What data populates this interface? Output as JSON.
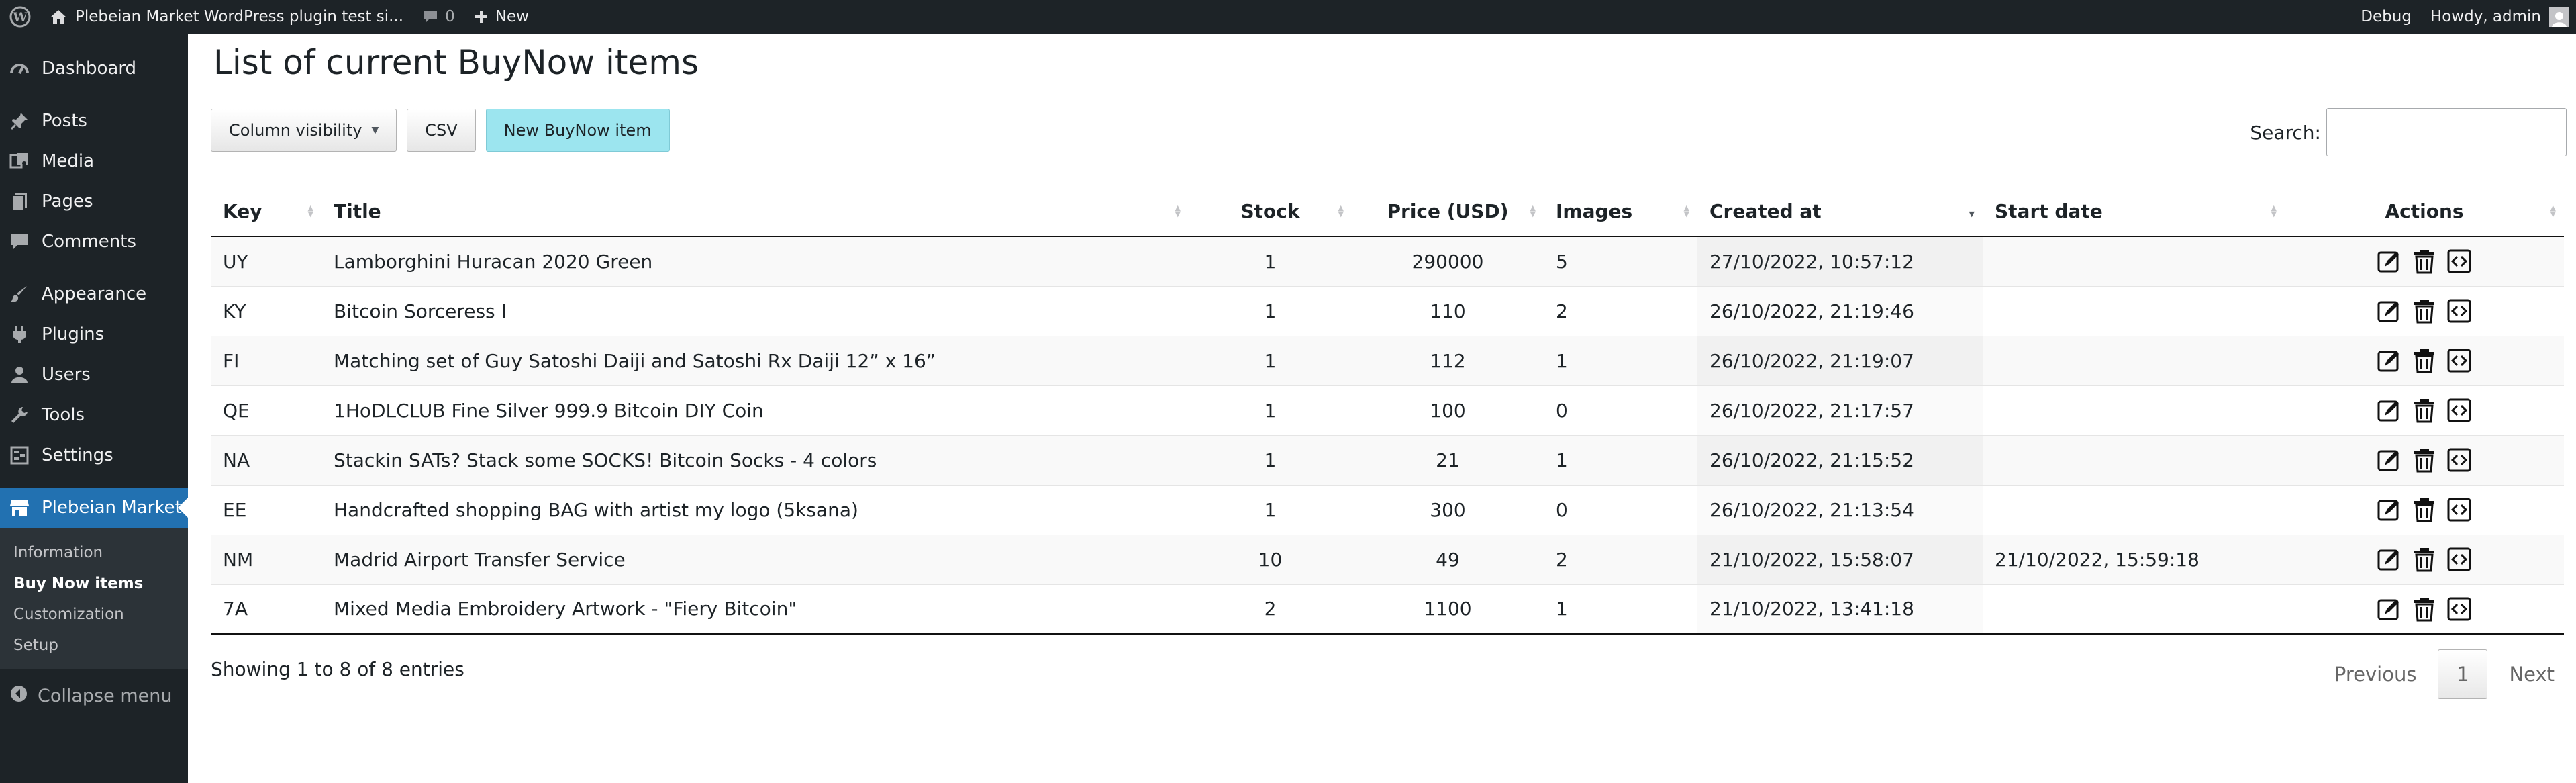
{
  "adminbar": {
    "site_name": "Plebeian Market WordPress plugin test si...",
    "comments_count": "0",
    "new_label": "New",
    "debug_label": "Debug",
    "howdy_label": "Howdy, admin"
  },
  "sidebar": {
    "items": [
      {
        "label": "Dashboard",
        "icon": "dashboard-icon"
      },
      {
        "label": "Posts",
        "icon": "pin-icon"
      },
      {
        "label": "Media",
        "icon": "media-icon"
      },
      {
        "label": "Pages",
        "icon": "pages-icon"
      },
      {
        "label": "Comments",
        "icon": "comment-icon"
      },
      {
        "label": "Appearance",
        "icon": "brush-icon"
      },
      {
        "label": "Plugins",
        "icon": "plugin-icon"
      },
      {
        "label": "Users",
        "icon": "user-icon"
      },
      {
        "label": "Tools",
        "icon": "wrench-icon"
      },
      {
        "label": "Settings",
        "icon": "settings-icon"
      },
      {
        "label": "Plebeian Market",
        "icon": "store-icon"
      }
    ],
    "submenu": [
      "Information",
      "Buy Now items",
      "Customization",
      "Setup"
    ],
    "collapse_label": "Collapse menu"
  },
  "page": {
    "title": "List of current BuyNow items",
    "buttons": {
      "column_visibility": "Column visibility",
      "csv": "CSV",
      "new_item": "New BuyNow item"
    },
    "search_label": "Search:",
    "search_value": ""
  },
  "table": {
    "columns": [
      "Key",
      "Title",
      "Stock",
      "Price (USD)",
      "Images",
      "Created at",
      "Start date",
      "Actions"
    ],
    "rows": [
      {
        "key": "UY",
        "title": "Lamborghini Huracan 2020 Green",
        "stock": "1",
        "price": "290000",
        "images": "5",
        "created": "27/10/2022, 10:57:12",
        "start": ""
      },
      {
        "key": "KY",
        "title": "Bitcoin Sorceress I",
        "stock": "1",
        "price": "110",
        "images": "2",
        "created": "26/10/2022, 21:19:46",
        "start": ""
      },
      {
        "key": "FI",
        "title": "Matching set of Guy Satoshi Daiji and Satoshi Rx Daiji 12” x 16”",
        "stock": "1",
        "price": "112",
        "images": "1",
        "created": "26/10/2022, 21:19:07",
        "start": ""
      },
      {
        "key": "QE",
        "title": "1HoDLCLUB Fine Silver 999.9 Bitcoin DIY Coin",
        "stock": "1",
        "price": "100",
        "images": "0",
        "created": "26/10/2022, 21:17:57",
        "start": ""
      },
      {
        "key": "NA",
        "title": "Stackin SATs? Stack some SOCKS! Bitcoin Socks - 4 colors",
        "stock": "1",
        "price": "21",
        "images": "1",
        "created": "26/10/2022, 21:15:52",
        "start": ""
      },
      {
        "key": "EE",
        "title": "Handcrafted shopping BAG with artist my logo (5ksana)",
        "stock": "1",
        "price": "300",
        "images": "0",
        "created": "26/10/2022, 21:13:54",
        "start": ""
      },
      {
        "key": "NM",
        "title": "Madrid Airport Transfer Service",
        "stock": "10",
        "price": "49",
        "images": "2",
        "created": "21/10/2022, 15:58:07",
        "start": "21/10/2022, 15:59:18"
      },
      {
        "key": "7A",
        "title": "Mixed Media Embroidery Artwork - \"Fiery Bitcoin\"",
        "stock": "2",
        "price": "1100",
        "images": "1",
        "created": "21/10/2022, 13:41:18",
        "start": ""
      }
    ]
  },
  "footer": {
    "info": "Showing 1 to 8 of 8 entries",
    "previous": "Previous",
    "current_page": "1",
    "next": "Next"
  }
}
